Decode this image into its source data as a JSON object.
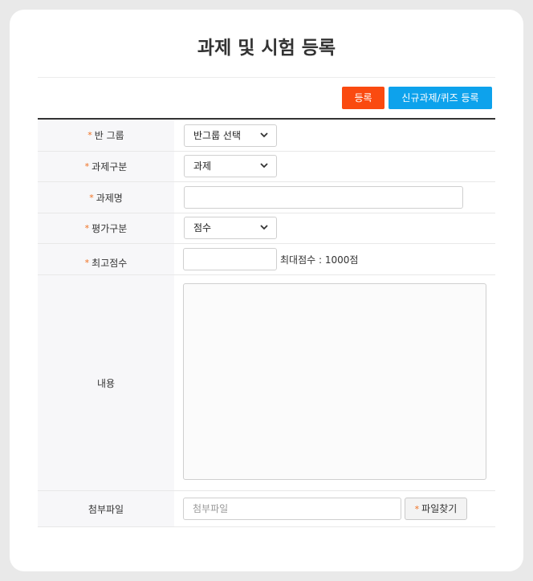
{
  "page": {
    "title": "과제 및 시험 등록"
  },
  "actions": {
    "register_label": "등록",
    "new_assignment_label": "신규과제/퀴즈 등록"
  },
  "form": {
    "required_mark": "*",
    "class_group": {
      "label": "반 그룹",
      "value": "반그룹 선택"
    },
    "assignment_type": {
      "label": "과제구분",
      "value": "과제"
    },
    "assignment_name": {
      "label": "과제명",
      "value": ""
    },
    "evaluation_type": {
      "label": "평가구분",
      "value": "점수"
    },
    "max_score": {
      "label": "최고점수",
      "value": "",
      "hint": "최대점수 : 1000점"
    },
    "content": {
      "label": "내용",
      "value": ""
    },
    "attachment": {
      "label": "첨부파일",
      "placeholder": "첨부파일",
      "button_label": "파일찾기"
    }
  },
  "colors": {
    "register": "#fa4a10",
    "new_assignment": "#0da2ec",
    "required": "#f07020"
  },
  "icons": {
    "select_arrow": "chevron-down-icon",
    "file_button": "plus-icon"
  }
}
